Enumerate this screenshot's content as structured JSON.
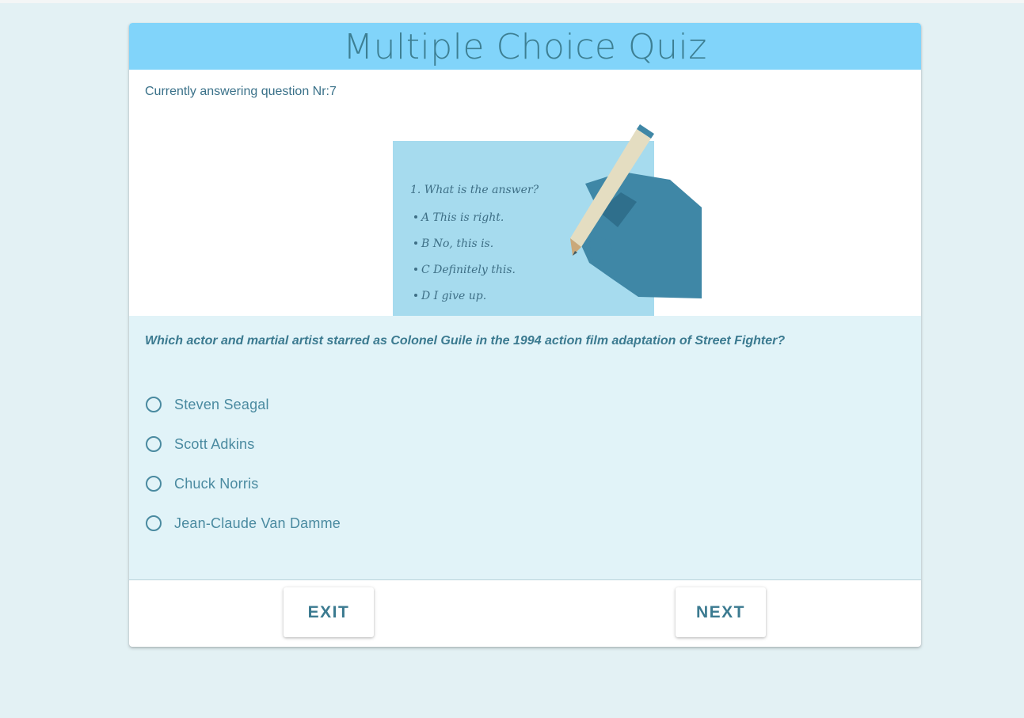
{
  "quiz": {
    "title": "Multiple Choice Quiz",
    "progress_text": "Currently answering question Nr:7",
    "illustration": {
      "question_line": "1. What is the answer?",
      "choices": [
        "A  This  is  right.",
        "B  No, this is.",
        "C  Definitely this.",
        "D  I give up."
      ]
    },
    "question": "Which actor and martial artist starred as Colonel Guile in the 1994 action film adaptation of Street Fighter?",
    "options": [
      {
        "label": "Steven Seagal"
      },
      {
        "label": "Scott Adkins"
      },
      {
        "label": "Chuck Norris"
      },
      {
        "label": "Jean-Claude Van Damme"
      }
    ],
    "exit_label": "EXIT",
    "next_label": "NEXT"
  },
  "colors": {
    "header_bg": "#81d4fa",
    "accent_text": "#3b7a90",
    "question_area_bg": "#e1f3f8",
    "page_bg": "#e3f1f4"
  }
}
